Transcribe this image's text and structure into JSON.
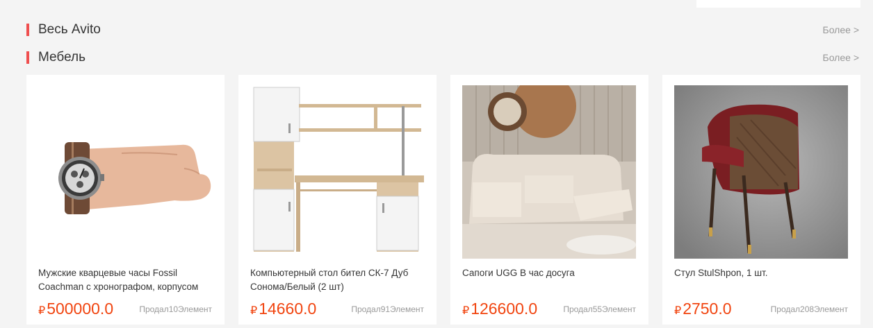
{
  "sections": [
    {
      "title": "Весь Avito",
      "more": "Более >"
    },
    {
      "title": "Мебель",
      "more": "Более >"
    }
  ],
  "products": [
    {
      "name": "Мужские кварцевые часы Fossil Coachman с хронографом, корпусом",
      "currency": "₽",
      "price": "500000.0",
      "sold": "Продал10Элемент",
      "image": "wristwatch-on-hand"
    },
    {
      "name": "Компьютерный стол бител СК-7 Дуб Сонома/Белый  (2 шт)",
      "currency": "₽",
      "price": "14660.0",
      "sold": "Продал91Элемент",
      "image": "computer-desk"
    },
    {
      "name": "Сапоги UGG В час досуга",
      "currency": "₽",
      "price": "126600.0",
      "sold": "Продал55Элемент",
      "image": "recliner-sofa"
    },
    {
      "name": "Стул StulShpon, 1 шт.",
      "currency": "₽",
      "price": "2750.0",
      "sold": "Продал208Элемент",
      "image": "dining-chair"
    }
  ]
}
